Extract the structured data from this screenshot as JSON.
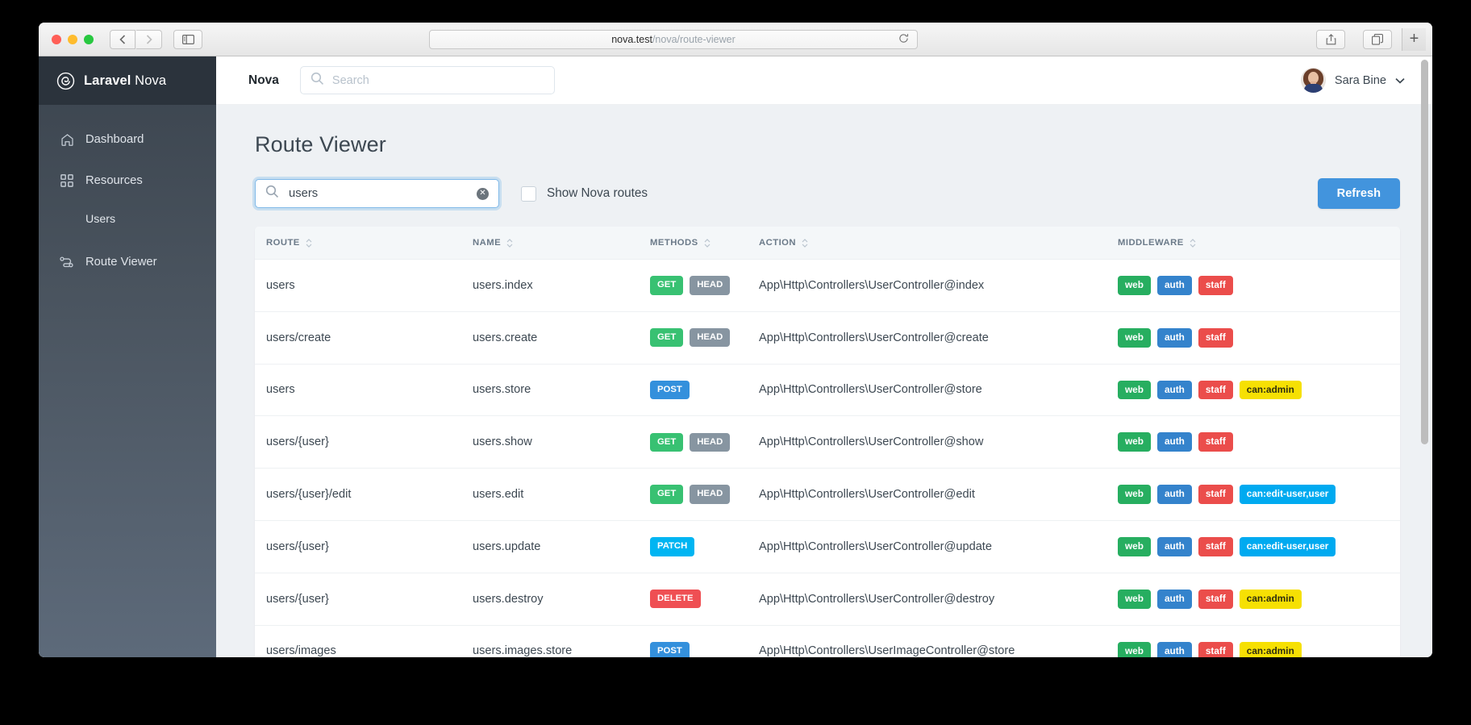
{
  "browser": {
    "url_host": "nova.test",
    "url_path": "/nova/route-viewer",
    "back_icon": "chevron-left-icon",
    "forward_icon": "chevron-right-icon",
    "sidebar_toggle_icon": "sidebar-toggle-icon",
    "reload_icon": "reload-icon",
    "share_icon": "share-icon",
    "tabs_icon": "tab-overview-icon",
    "new_tab_label": "+"
  },
  "sidebar": {
    "brand_bold": "Laravel",
    "brand_light": " Nova",
    "items": [
      {
        "label": "Dashboard",
        "icon": "home-icon"
      },
      {
        "label": "Resources",
        "icon": "grid-icon"
      }
    ],
    "sub_items": [
      {
        "label": "Users"
      }
    ],
    "route_viewer": {
      "label": "Route Viewer",
      "icon": "route-icon"
    }
  },
  "topbar": {
    "title": "Nova",
    "search_placeholder": "Search",
    "search_value": "",
    "search_icon": "search-icon",
    "user_name": "Sara Bine",
    "chevron_icon": "chevron-down-icon",
    "avatar": "user-avatar"
  },
  "page": {
    "title": "Route Viewer",
    "search_value": "users",
    "search_icon": "search-icon",
    "clear_icon": "clear-circle-icon",
    "clear_glyph": "✕",
    "checkbox_label": "Show Nova routes",
    "checkbox_checked": false,
    "refresh_label": "Refresh"
  },
  "table": {
    "columns": [
      "ROUTE",
      "NAME",
      "METHODS",
      "ACTION",
      "MIDDLEWARE"
    ],
    "rows": [
      {
        "route": "users",
        "name": "users.index",
        "methods": [
          "GET",
          "HEAD"
        ],
        "action": "App\\Http\\Controllers\\UserController@index",
        "middleware": [
          "web",
          "auth",
          "staff"
        ]
      },
      {
        "route": "users/create",
        "name": "users.create",
        "methods": [
          "GET",
          "HEAD"
        ],
        "action": "App\\Http\\Controllers\\UserController@create",
        "middleware": [
          "web",
          "auth",
          "staff"
        ]
      },
      {
        "route": "users",
        "name": "users.store",
        "methods": [
          "POST"
        ],
        "action": "App\\Http\\Controllers\\UserController@store",
        "middleware": [
          "web",
          "auth",
          "staff",
          "can:admin"
        ]
      },
      {
        "route": "users/{user}",
        "name": "users.show",
        "methods": [
          "GET",
          "HEAD"
        ],
        "action": "App\\Http\\Controllers\\UserController@show",
        "middleware": [
          "web",
          "auth",
          "staff"
        ]
      },
      {
        "route": "users/{user}/edit",
        "name": "users.edit",
        "methods": [
          "GET",
          "HEAD"
        ],
        "action": "App\\Http\\Controllers\\UserController@edit",
        "middleware": [
          "web",
          "auth",
          "staff",
          "can:edit-user,user"
        ]
      },
      {
        "route": "users/{user}",
        "name": "users.update",
        "methods": [
          "PATCH"
        ],
        "action": "App\\Http\\Controllers\\UserController@update",
        "middleware": [
          "web",
          "auth",
          "staff",
          "can:edit-user,user"
        ]
      },
      {
        "route": "users/{user}",
        "name": "users.destroy",
        "methods": [
          "DELETE"
        ],
        "action": "App\\Http\\Controllers\\UserController@destroy",
        "middleware": [
          "web",
          "auth",
          "staff",
          "can:admin"
        ]
      },
      {
        "route": "users/images",
        "name": "users.images.store",
        "methods": [
          "POST"
        ],
        "action": "App\\Http\\Controllers\\UserImageController@store",
        "middleware": [
          "web",
          "auth",
          "staff",
          "can:admin"
        ]
      }
    ]
  },
  "colors": {
    "method_GET": "#38c172",
    "method_HEAD": "#8795a1",
    "method_POST": "#3490dc",
    "method_PATCH": "#00b5f2",
    "method_DELETE": "#ef4f53",
    "mw_web": "#27ae60",
    "mw_auth": "#3483cc",
    "mw_staff": "#eb4d4b",
    "mw_can_admin": "#f6e003",
    "mw_can_edit": "#00aaf0",
    "accent_blue": "#4294dd",
    "sidebar_top": "#3b444e",
    "sidebar_bottom": "#5d6a7a",
    "brand_bar": "#2b333c",
    "page_bg": "#eef1f4"
  }
}
